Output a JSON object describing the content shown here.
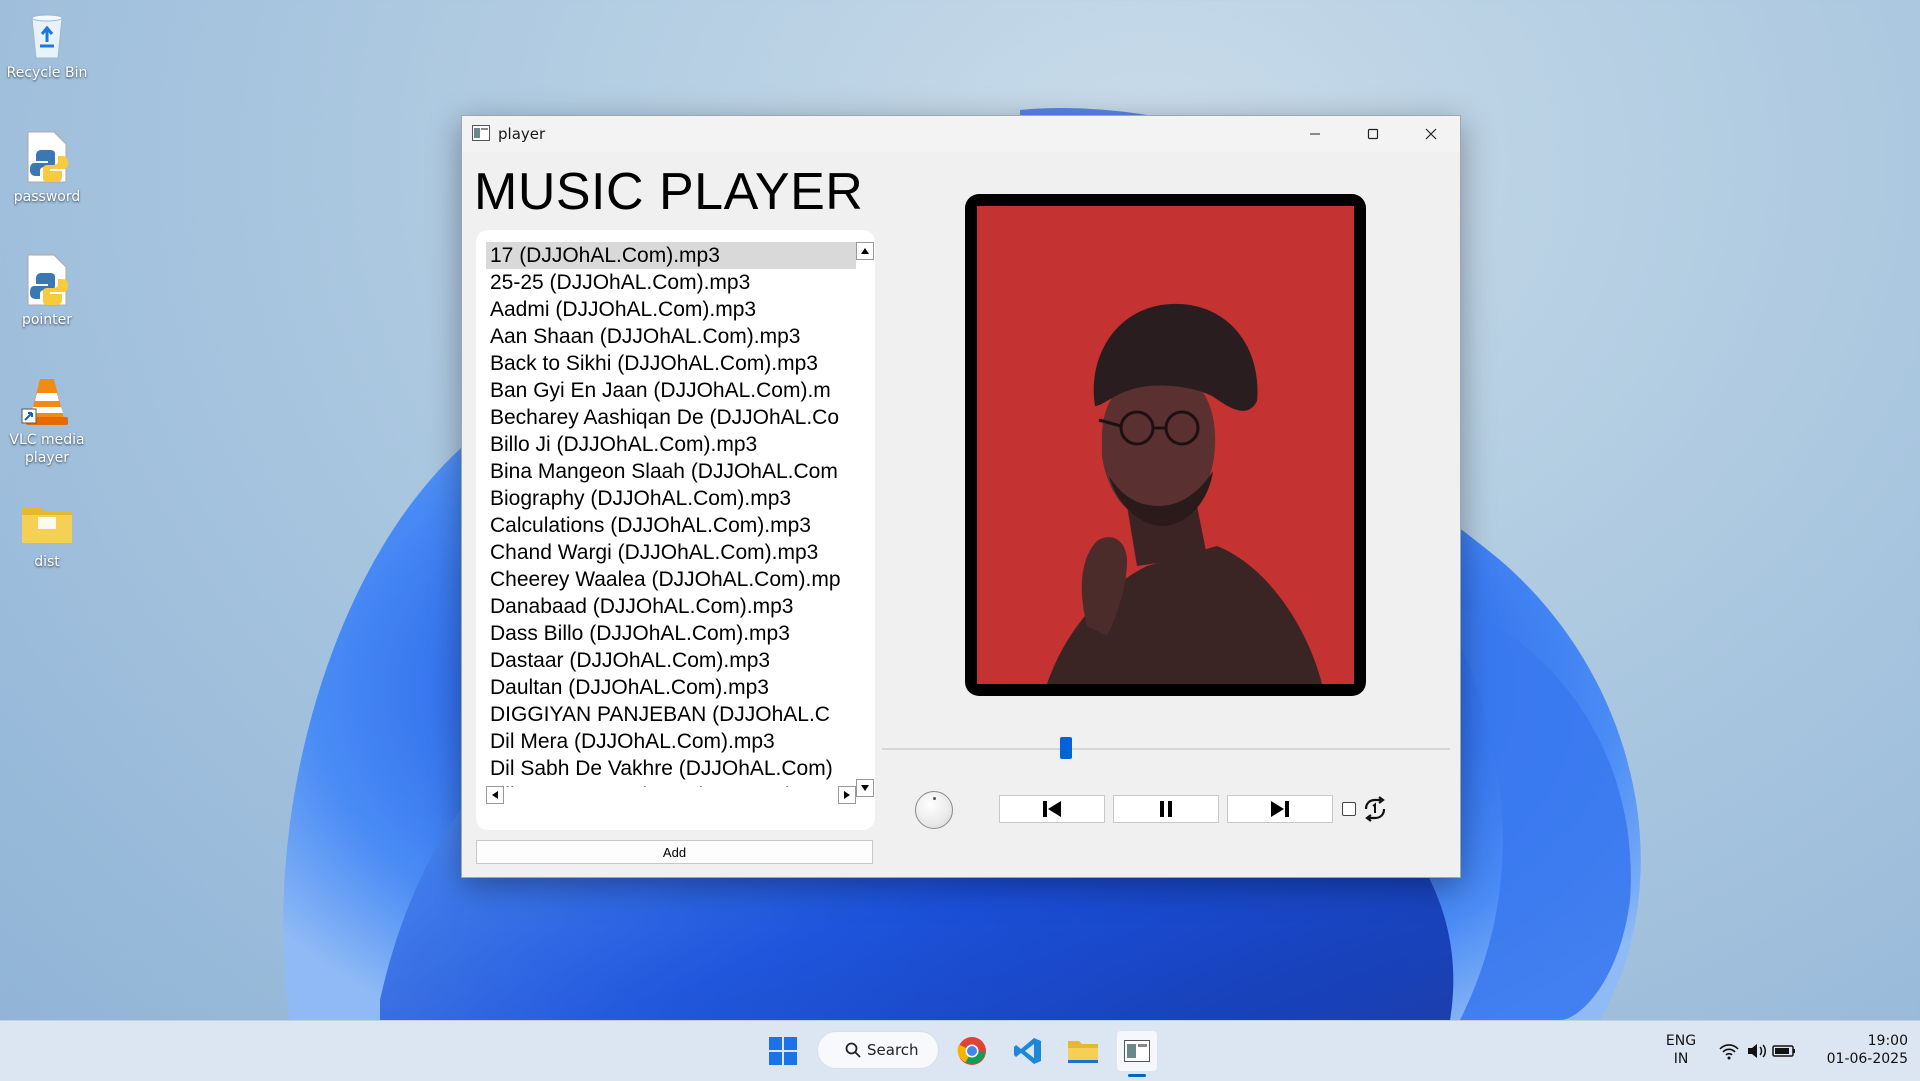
{
  "desktop": {
    "icons": [
      {
        "label": "Recycle Bin",
        "icon": "recycle-bin-icon"
      },
      {
        "label": "password",
        "icon": "python-file-icon"
      },
      {
        "label": "pointer",
        "icon": "python-file-icon"
      },
      {
        "label": "VLC media player",
        "icon": "vlc-icon"
      },
      {
        "label": "dist",
        "icon": "folder-icon"
      }
    ]
  },
  "window": {
    "title": "player",
    "heading": "MUSIC PLAYER",
    "songs": [
      "17 (DJJOhAL.Com).mp3",
      "25-25 (DJJOhAL.Com).mp3",
      "Aadmi (DJJOhAL.Com).mp3",
      "Aan Shaan (DJJOhAL.Com).mp3",
      "Back to Sikhi (DJJOhAL.Com).mp3",
      "Ban Gyi En Jaan (DJJOhAL.Com).m",
      "Becharey Aashiqan De (DJJOhAL.Co",
      "Billo Ji (DJJOhAL.Com).mp3",
      "Bina Mangeon Slaah (DJJOhAL.Com",
      "Biography (DJJOhAL.Com).mp3",
      "Calculations (DJJOhAL.Com).mp3",
      "Chand Wargi (DJJOhAL.Com).mp3",
      "Cheerey Waalea (DJJOhAL.Com).mp",
      "Danabaad (DJJOhAL.Com).mp3",
      "Dass Billo (DJJOhAL.Com).mp3",
      "Dastaar (DJJOhAL.Com).mp3",
      "Daultan (DJJOhAL.Com).mp3",
      "DIGGIYAN PANJEBAN (DJJOhAL.C",
      "Dil Mera (DJJOhAL.Com).mp3",
      "Dil Sabh De Vakhre (DJJOhAL.Com)",
      "Dil Toot Javega (DJJOhAL.Com).mp"
    ],
    "selected_index": 0,
    "add_label": "Add",
    "seek_position": 0.32,
    "repeat_checked": false
  },
  "taskbar": {
    "search_label": "Search",
    "lang_top": "ENG",
    "lang_bottom": "IN",
    "time": "19:00",
    "date": "01-06-2025"
  },
  "colors": {
    "accent": "#0063d6",
    "album_bg": "#c43231"
  }
}
